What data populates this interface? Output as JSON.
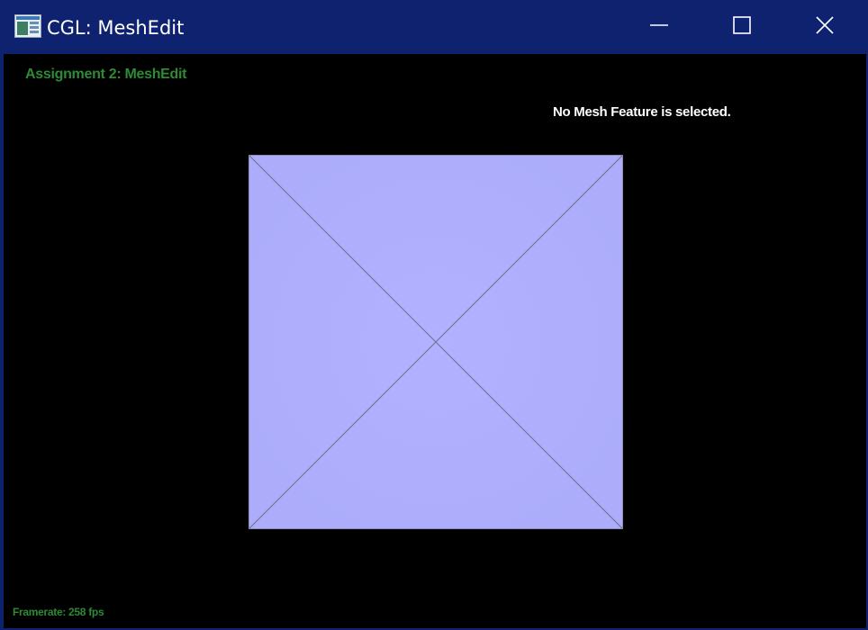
{
  "window": {
    "title": "CGL: MeshEdit",
    "icons": {
      "app": "app-window-icon",
      "minimize": "minimize-icon",
      "maximize": "maximize-icon",
      "close": "close-icon"
    }
  },
  "viewport": {
    "assignment_title": "Assignment 2: MeshEdit",
    "selection_status": "No Mesh Feature is selected.",
    "framerate": "Framerate: 258 fps"
  },
  "colors": {
    "titlebar": "#0e2270",
    "viewport_background": "#000000",
    "hud_green": "#2f8a36",
    "mesh_fill": "#b0b0ff",
    "mesh_edges": "#7f7f99"
  }
}
